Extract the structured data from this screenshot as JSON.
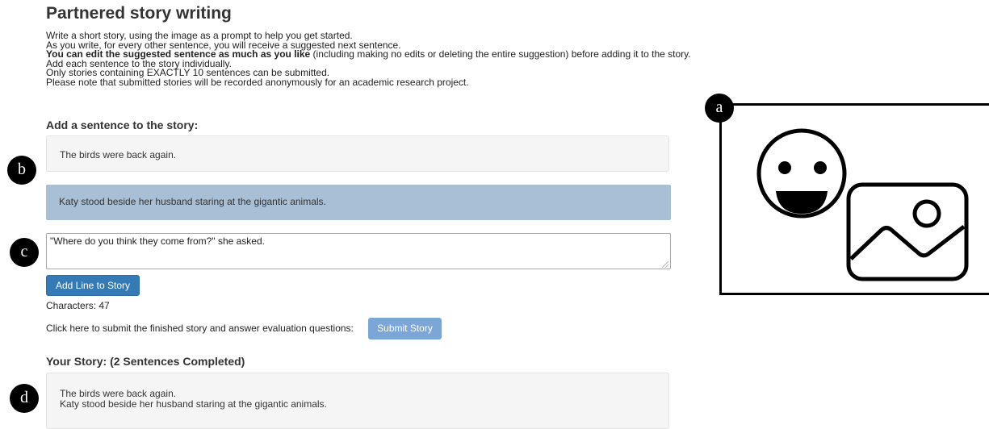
{
  "page": {
    "title": "Partnered story writing",
    "instructions": {
      "line1": "Write a short story, using the image as a prompt to help you get started.",
      "line2": "As you write, for every other sentence, you will receive a suggested next sentence.",
      "line3_bold": "You can edit the suggested sentence as much as you like",
      "line3_rest": " (including making no edits or deleting the entire suggestion) before adding it to the story.",
      "line4": "Add each sentence to the story individually.",
      "line5": "Only stories containing EXACTLY 10 sentences can be submitted.",
      "line6": "Please note that submitted stories will be recorded anonymously for an academic research project."
    }
  },
  "add_section": {
    "heading": "Add a sentence to the story:",
    "previous_sentence": "The birds were back again.",
    "suggested_sentence": "Katy stood beside her husband staring at the gigantic animals.",
    "input_value": "\"Where do you think they come from?\" she asked.",
    "add_button_label": "Add Line to Story",
    "characters_text": "Characters: 47"
  },
  "submit": {
    "prompt": "Click here to submit the finished story and answer evaluation questions:",
    "button_label": "Submit Story"
  },
  "story": {
    "heading": "Your Story: (2 Sentences Completed)",
    "lines": [
      "The birds were back again.",
      "Katy stood beside her husband staring at the gigantic animals."
    ]
  },
  "markers": {
    "a": "a",
    "b": "b",
    "c": "c",
    "d": "d"
  },
  "icons": {
    "image_prompt": [
      "smiley-face-icon",
      "landscape-image-icon"
    ]
  },
  "colors": {
    "primary_button": "#337ab7",
    "submit_button": "#7ca5d8",
    "suggestion_background": "#a8bfd6",
    "panel_background": "#f5f5f5"
  }
}
